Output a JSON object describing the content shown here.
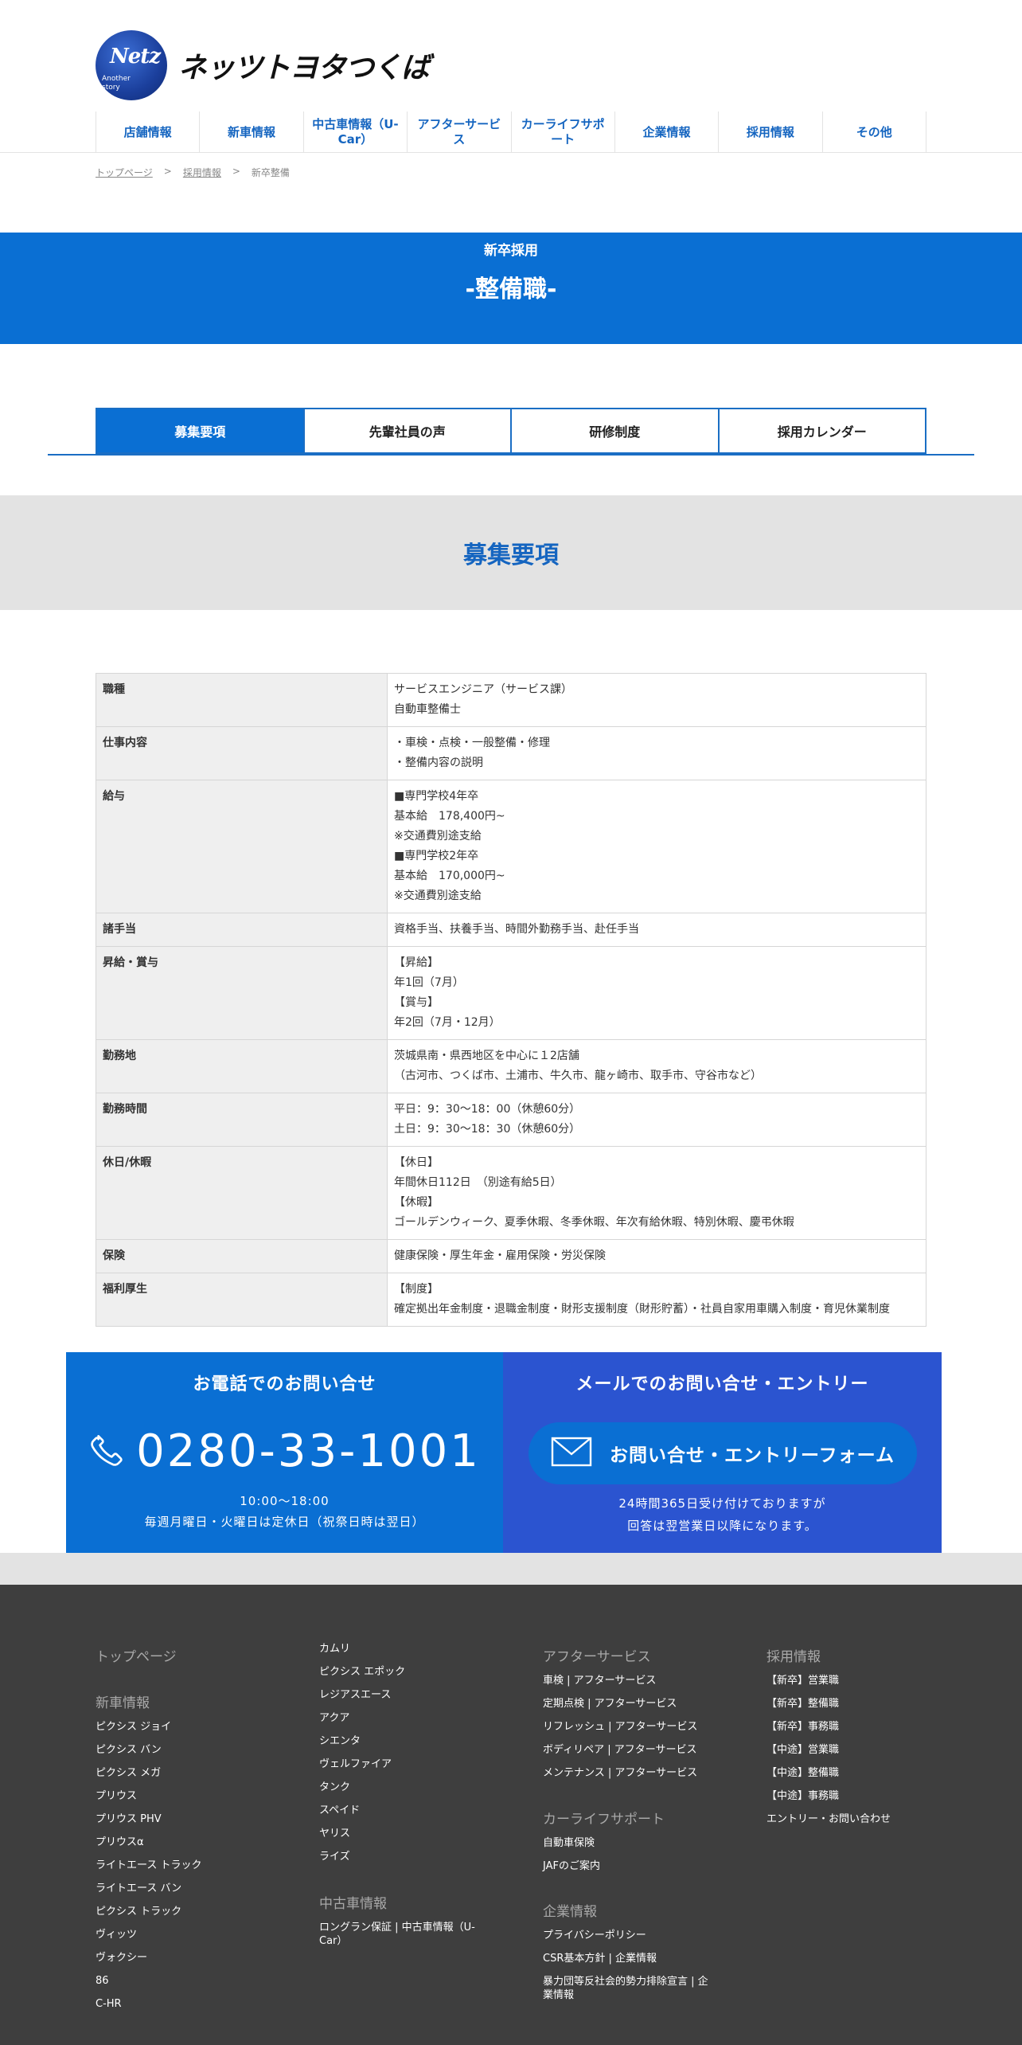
{
  "brand": {
    "logo_mark": "Netz",
    "logo_sub_1": "Another",
    "logo_sub_2": "story",
    "name": "ネッツトヨタつくば",
    "accent": "#0a6fd3",
    "contact_mail_bg": "#2b54d0",
    "footer_bg": "#3e3e3e"
  },
  "nav": [
    "店舗情報",
    "新車情報",
    "中古車情報（U-Car）",
    "アフターサービス",
    "カーライフサポート",
    "企業情報",
    "採用情報",
    "その他"
  ],
  "breadcrumb": {
    "home": "トップページ",
    "sep1": ">",
    "recruit": "採用情報",
    "sep2": ">",
    "current": "新卒整備"
  },
  "banner": {
    "category": "新卒採用",
    "title": "-整備職-"
  },
  "tabs": [
    {
      "label": "募集要項",
      "active": true
    },
    {
      "label": "先輩社員の声",
      "active": false
    },
    {
      "label": "研修制度",
      "active": false
    },
    {
      "label": "採用カレンダー",
      "active": false
    }
  ],
  "section_title": "募集要項",
  "requirements": [
    {
      "label": "職種",
      "value": "サービスエンジニア（サービス課）\n自動車整備士"
    },
    {
      "label": "仕事内容",
      "value": "・車検・点検・一般整備・修理\n・整備内容の説明"
    },
    {
      "label": "給与",
      "value": "■専門学校4年卒\n基本給　178,400円~\n※交通費別途支給\n■専門学校2年卒\n基本給　170,000円~\n※交通費別途支給"
    },
    {
      "label": "諸手当",
      "value": "資格手当、扶養手当、時間外勤務手当、赴任手当"
    },
    {
      "label": "昇給・賞与",
      "value": "【昇給】\n年1回（7月）\n【賞与】\n年2回（7月・12月）"
    },
    {
      "label": "勤務地",
      "value": "茨城県南・県西地区を中心に１2店舗\n（古河市、つくば市、土浦市、牛久市、龍ヶ崎市、取手市、守谷市など）"
    },
    {
      "label": "勤務時間",
      "value": "平日：9：30～18：00（休憩60分）\n土日：9：30～18：30（休憩60分）"
    },
    {
      "label": "休日/休暇",
      "value": "【休日】\n年間休日112日　（別途有給5日）\n【休暇】\nゴールデンウィーク、夏季休暇、冬季休暇、年次有給休暇、特別休暇、慶弔休暇"
    },
    {
      "label": "保険",
      "value": "健康保険・厚生年金・雇用保険・労災保険"
    },
    {
      "label": "福利厚生",
      "value": "【制度】\n確定拠出年金制度・退職金制度・財形支援制度（財形貯蓄）・社員自家用車購入制度・育児休業制度"
    }
  ],
  "contact": {
    "phone_heading": "お電話でのお問い合せ",
    "phone_number": "0280-33-1001",
    "phone_hours": "10:00〜18:00",
    "phone_note": "毎週月曜日・火曜日は定休日（祝祭日時は翌日）",
    "mail_heading": "メールでのお問い合せ・エントリー",
    "mail_button": "お問い合せ・エントリーフォーム",
    "mail_note_1": "24時間365日受け付けておりますが",
    "mail_note_2": "回答は翌営業日以降になります。"
  },
  "footer": {
    "col1": {
      "top": "トップページ",
      "newcar_head": "新車情報",
      "links": [
        "ピクシス ジョイ",
        "ピクシス バン",
        "ピクシス メガ",
        "プリウス",
        "プリウス PHV",
        "プリウスα",
        "ライトエース トラック",
        "ライトエース バン",
        "ピクシス トラック",
        "ヴィッツ",
        "ヴォクシー",
        "86",
        "C-HR"
      ]
    },
    "col2": {
      "links": [
        "カムリ",
        "ピクシス エポック",
        "レジアスエース",
        "アクア",
        "シエンタ",
        "ヴェルファイア",
        "タンク",
        "スペイド",
        "ヤリス",
        "ライズ"
      ],
      "ucar_head": "中古車情報",
      "ucar_link": "ロングラン保証 | 中古車情報（U-Car）"
    },
    "col3": {
      "after_head": "アフターサービス",
      "after_links": [
        "車検 | アフターサービス",
        "定期点検 | アフターサービス",
        "リフレッシュ | アフターサービス",
        "ボディリペア | アフターサービス",
        "メンテナンス | アフターサービス"
      ],
      "life_head": "カーライフサポート",
      "life_links": [
        "自動車保険",
        "JAFのご案内"
      ],
      "corp_head": "企業情報",
      "corp_links": [
        "プライバシーポリシー",
        "CSR基本方針 | 企業情報",
        "暴力団等反社会的勢力排除宣言 | 企業情報"
      ]
    },
    "col4": {
      "head": "採用情報",
      "links": [
        "【新卒】営業職",
        "【新卒】整備職",
        "【新卒】事務職",
        "【中途】営業職",
        "【中途】整備職",
        "【中途】事務職",
        "エントリー・お問い合わせ"
      ]
    }
  }
}
